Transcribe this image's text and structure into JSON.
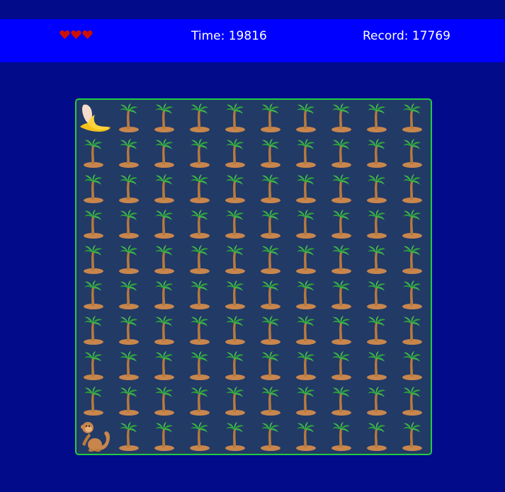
{
  "header": {
    "lives": 3,
    "time_text": "Time: 19816",
    "record_text": "Record: 17769"
  },
  "colors": {
    "background": "#020b8a",
    "header_bar": "#0000ff",
    "board": "#223a66",
    "board_border": "#22cc44",
    "heart": "#cc1100"
  },
  "board": {
    "rows": 10,
    "cols": 10,
    "banana": {
      "row": 0,
      "col": 0
    },
    "monkey": {
      "row": 9,
      "col": 0
    },
    "tile_icon": "palm-tree-icon",
    "banana_icon": "banana-icon",
    "monkey_icon": "monkey-icon"
  }
}
